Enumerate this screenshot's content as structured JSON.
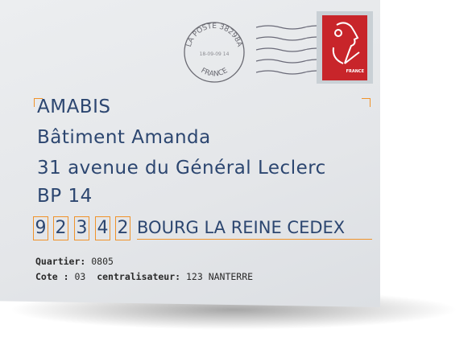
{
  "stamp": {
    "country": "FRANCE",
    "color": "#c8252a"
  },
  "postmark": {
    "top_text": "LA POSTE 38298A",
    "bottom_text": "FRANCE",
    "date": "18-09-09 14"
  },
  "address": {
    "line1": "AMABIS",
    "line2": "Bâtiment Amanda",
    "line3": "31 avenue du Général Leclerc",
    "line4": "BP 14",
    "postal_digits": [
      "9",
      "2",
      "3",
      "4",
      "2"
    ],
    "city": "BOURG LA REINE CEDEX"
  },
  "routing": {
    "quartier_label": "Quartier:",
    "quartier_value": "0805",
    "cote_label": "Cote :",
    "cote_value": "03",
    "centralisateur_label": "centralisateur:",
    "centralisateur_value": "123 NANTERRE"
  },
  "colors": {
    "ink": "#2c4670",
    "guide": "#f0932b"
  }
}
